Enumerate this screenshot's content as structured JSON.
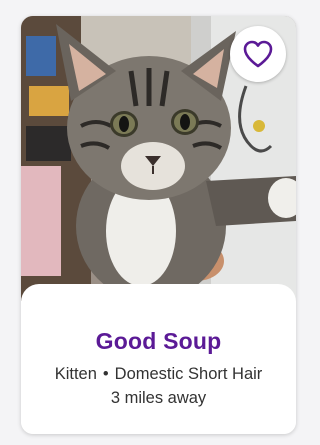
{
  "pet": {
    "name": "Good Soup",
    "age": "Kitten",
    "separator": "•",
    "breed": "Domestic Short Hair",
    "distance": "3 miles away",
    "photo_icon": "kitten-photo"
  },
  "favorite": {
    "icon": "heart-outline-icon",
    "color": "#5b1a96"
  },
  "colors": {
    "brand": "#5b1a96",
    "text": "#333333",
    "card": "#ffffff",
    "background": "#f4f4f6"
  }
}
